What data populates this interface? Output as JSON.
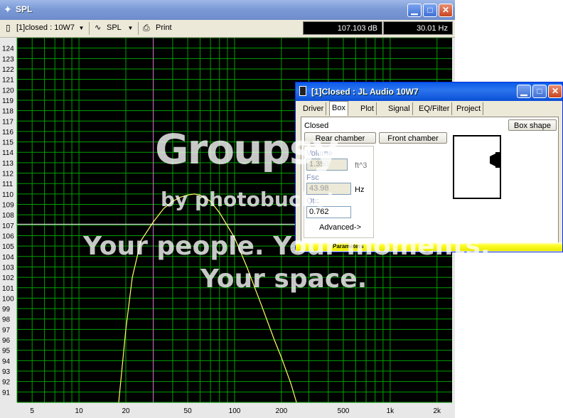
{
  "window": {
    "title": "SPL",
    "toolbar": {
      "project_select": "[1]closed : 10W7",
      "spl_select": "SPL",
      "print_label": "Print"
    },
    "readouts": {
      "level": "107.103 dB",
      "frequency": "30.01 Hz"
    }
  },
  "chart_data": {
    "type": "line",
    "x_scale": "log",
    "xlim": [
      4,
      2500
    ],
    "ylim": [
      90,
      125
    ],
    "x_ticks": [
      5,
      10,
      20,
      50,
      100,
      200,
      500,
      "1k",
      "2k"
    ],
    "x_tick_values": [
      5,
      10,
      20,
      50,
      100,
      200,
      500,
      1000,
      2000
    ],
    "y_ticks": [
      124,
      123,
      122,
      121,
      120,
      119,
      118,
      117,
      116,
      115,
      114,
      113,
      112,
      111,
      110,
      109,
      108,
      107,
      106,
      105,
      104,
      103,
      102,
      101,
      100,
      99,
      98,
      97,
      96,
      95,
      94,
      93,
      92,
      91
    ],
    "grid": true,
    "cursor": {
      "x": 30.01,
      "y": 107.103
    },
    "series": [
      {
        "color": "#ffff66",
        "points": [
          [
            18,
            90
          ],
          [
            20,
            97
          ],
          [
            22,
            102
          ],
          [
            25,
            105.5
          ],
          [
            30,
            107.3
          ],
          [
            35,
            108.6
          ],
          [
            40,
            109.3
          ],
          [
            45,
            109.7
          ],
          [
            50,
            109.9
          ],
          [
            55,
            110.0
          ],
          [
            60,
            109.9
          ],
          [
            70,
            109.3
          ],
          [
            80,
            108.2
          ],
          [
            100,
            105.8
          ],
          [
            120,
            103.0
          ],
          [
            150,
            99.2
          ],
          [
            180,
            96.0
          ],
          [
            200,
            94.3
          ],
          [
            230,
            91.8
          ],
          [
            250,
            90
          ]
        ]
      }
    ],
    "colors": {
      "background": "#000000",
      "grid": "#00a000",
      "curve": "#ffff66",
      "cursor_v": "#d070d0",
      "cursor_h": "#ffffff"
    }
  },
  "dialog": {
    "title": "[1]Closed : JL Audio 10W7",
    "tabs": [
      "Driver",
      "Box",
      "Plot",
      "Signal",
      "EQ/Filter",
      "Project"
    ],
    "active_tab": "Box",
    "box_type": "Closed",
    "box_shape_button": "Box shape",
    "rear_chamber_button": "Rear chamber",
    "front_chamber_button": "Front chamber",
    "volume_label": "Volume",
    "volume_value": "1.350",
    "volume_unit": "ft^3",
    "fsc_label": "Fsc",
    "fsc_value": "43.98",
    "fsc_unit": "Hz",
    "qtc_label": "Qtc",
    "qtc_value": "0.762",
    "advanced_label": "Advanced->",
    "parameters_label": "Parameters"
  },
  "watermark": {
    "brand": "Groupsy",
    "byline": "by photobucket",
    "line1": "Your people. Your moments.",
    "line2": "Your space."
  }
}
